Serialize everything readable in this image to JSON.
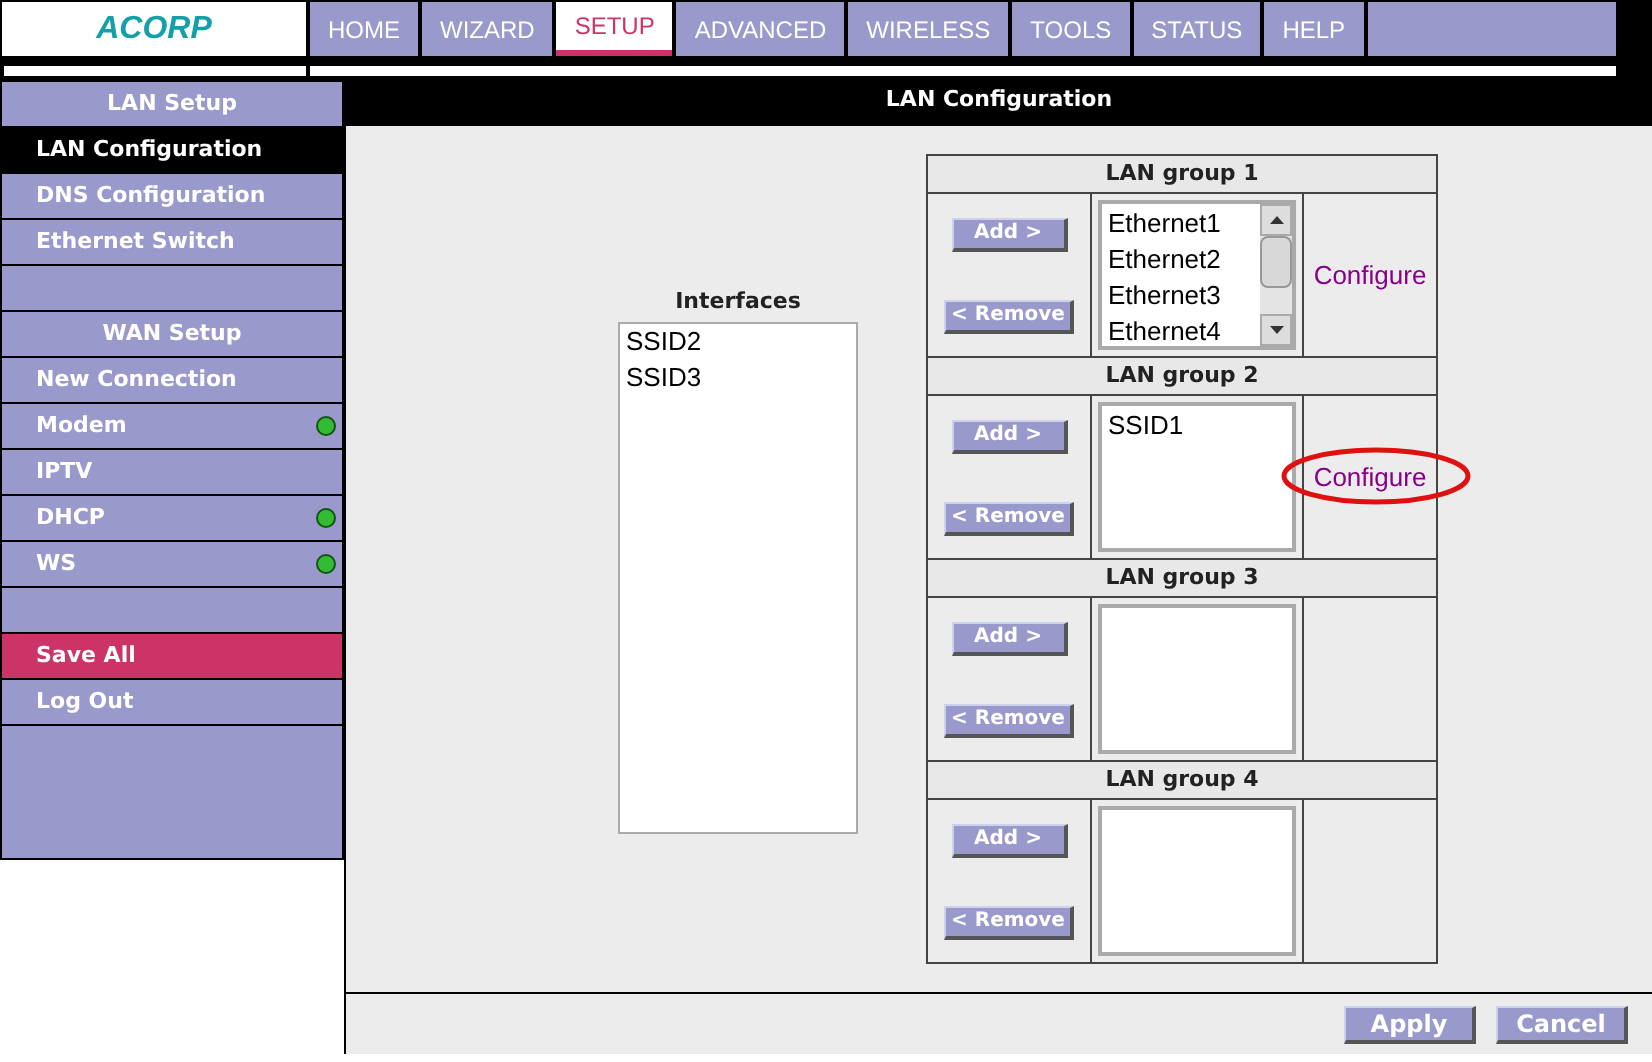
{
  "logo": {
    "text": "ACORP"
  },
  "nav": [
    {
      "label": "HOME",
      "selected": false
    },
    {
      "label": "WIZARD",
      "selected": false
    },
    {
      "label": "SETUP",
      "selected": true
    },
    {
      "label": "ADVANCED",
      "selected": false
    },
    {
      "label": "WIRELESS",
      "selected": false
    },
    {
      "label": "TOOLS",
      "selected": false
    },
    {
      "label": "STATUS",
      "selected": false
    },
    {
      "label": "HELP",
      "selected": false
    }
  ],
  "sidebar": {
    "items": [
      {
        "kind": "header",
        "label": "LAN Setup"
      },
      {
        "kind": "item",
        "label": "LAN Configuration",
        "selected": true,
        "connected": false
      },
      {
        "kind": "item",
        "label": "DNS Configuration",
        "selected": false,
        "connected": false
      },
      {
        "kind": "item",
        "label": "Ethernet Switch",
        "selected": false,
        "connected": false
      },
      {
        "kind": "spacer"
      },
      {
        "kind": "header",
        "label": "WAN Setup"
      },
      {
        "kind": "item",
        "label": "New Connection",
        "selected": false,
        "connected": false
      },
      {
        "kind": "item",
        "label": "Modem",
        "selected": false,
        "connected": true
      },
      {
        "kind": "item",
        "label": "IPTV",
        "selected": false,
        "connected": false
      },
      {
        "kind": "item",
        "label": "DHCP",
        "selected": false,
        "connected": true
      },
      {
        "kind": "item",
        "label": "WS",
        "selected": false,
        "connected": true
      },
      {
        "kind": "spacer"
      },
      {
        "kind": "action",
        "label": "Save All"
      },
      {
        "kind": "item",
        "label": "Log Out",
        "selected": false,
        "connected": false
      }
    ]
  },
  "panel": {
    "title": "LAN Configuration",
    "interfaces": {
      "label": "Interfaces",
      "items": [
        "SSID2",
        "SSID3"
      ]
    },
    "groups": [
      {
        "title": "LAN group 1",
        "add": "Add >",
        "remove": "< Remove",
        "members": [
          "Ethernet1",
          "Ethernet2",
          "Ethernet3",
          "Ethernet4"
        ],
        "scrollbar": true,
        "configure": "Configure",
        "circled": false
      },
      {
        "title": "LAN group 2",
        "add": "Add >",
        "remove": "< Remove",
        "members": [
          "SSID1"
        ],
        "scrollbar": false,
        "configure": "Configure",
        "circled": true
      },
      {
        "title": "LAN group 3",
        "add": "Add >",
        "remove": "< Remove",
        "scrollbar": false
      },
      {
        "title": "LAN group 4",
        "add": "Add >",
        "remove": "< Remove",
        "scrollbar": false
      }
    ],
    "buttons": [
      "Apply",
      "Cancel"
    ]
  }
}
